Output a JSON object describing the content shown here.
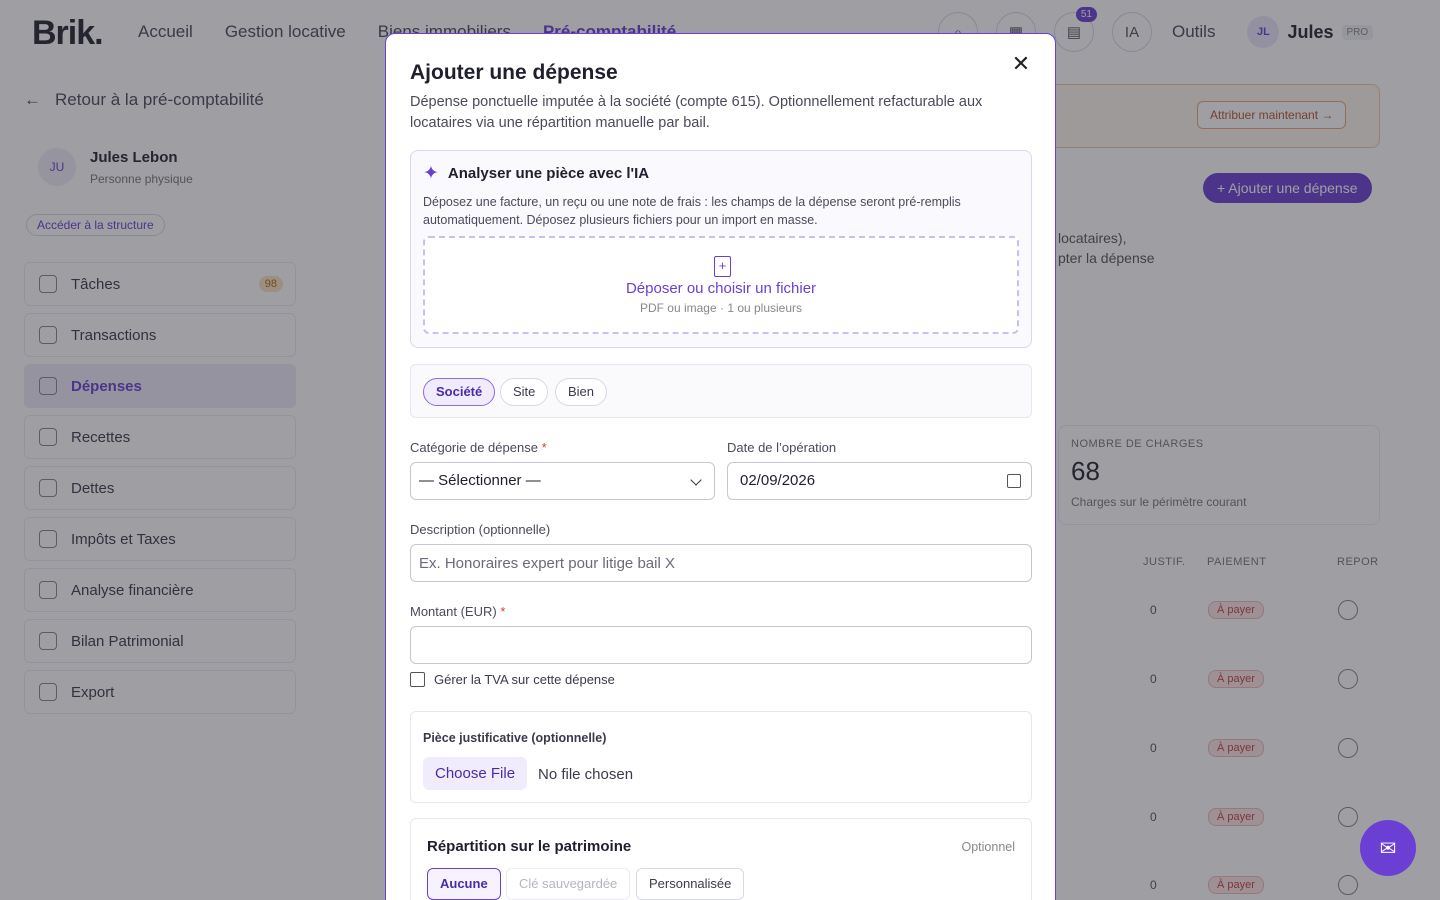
{
  "app": {
    "logo": "Brik.",
    "nav": [
      "Accueil",
      "Gestion locative",
      "Biens immobiliers",
      "Pré-comptabilité"
    ],
    "notifications_count": "51",
    "ai_label": "IA",
    "tools_label": "Outils",
    "user": {
      "initials": "JL",
      "name": "Jules",
      "plan": "PRO"
    }
  },
  "sidebar": {
    "back_label": "Retour à la pré-comptabilité",
    "profile": {
      "initials": "JU",
      "name": "Jules Lebon",
      "type": "Personne physique"
    },
    "structure_link": "Accéder à la structure",
    "items": [
      {
        "label": "Tâches",
        "badge": "98"
      },
      {
        "label": "Transactions"
      },
      {
        "label": "Dépenses"
      },
      {
        "label": "Recettes"
      },
      {
        "label": "Dettes"
      },
      {
        "label": "Impôts et Taxes"
      },
      {
        "label": "Analyse financière"
      },
      {
        "label": "Bilan Patrimonial"
      },
      {
        "label": "Export"
      }
    ]
  },
  "background": {
    "banner_button": "Attribuer maintenant →",
    "add_button": "+ Ajouter une dépense",
    "partial_text_1": "locataires),",
    "partial_text_2": "pter la dépense",
    "stat": {
      "label": "NOMBRE DE CHARGES",
      "value": "68",
      "sub": "Charges sur le périmètre courant"
    },
    "columns": [
      "JUSTIF.",
      "PAIEMENT",
      "REPOR"
    ],
    "row_count": "0",
    "row_status": "À payer"
  },
  "modal": {
    "title": "Ajouter une dépense",
    "description": "Dépense ponctuelle imputée à la société (compte 615). Optionnellement refacturable aux locataires via une répartition manuelle par bail.",
    "ai": {
      "title": "Analyser une pièce avec l'IA",
      "description": "Déposez une facture, un reçu ou une note de frais : les champs de la dépense seront pré-remplis automatiquement. Déposez plusieurs fichiers pour un import en masse.",
      "drop_title": "Déposer ou choisir un fichier",
      "drop_sub": "PDF ou image · 1 ou plusieurs"
    },
    "scope": {
      "options": [
        "Société",
        "Site",
        "Bien"
      ],
      "selected": "Société"
    },
    "category": {
      "label": "Catégorie de dépense",
      "value": "— Sélectionner —"
    },
    "date": {
      "label": "Date de l’opération",
      "value": "02/09/2026"
    },
    "description_field": {
      "label": "Description (optionnelle)",
      "placeholder": "Ex. Honoraires expert pour litige bail X",
      "value": ""
    },
    "amount": {
      "label": "Montant (EUR)",
      "value": ""
    },
    "vat_checkbox": {
      "label": "Gérer la TVA sur cette dépense",
      "checked": false
    },
    "proof": {
      "label": "Pièce justificative (optionnelle)",
      "button": "Choose File",
      "status": "No file chosen"
    },
    "repartition": {
      "title": "Répartition sur le patrimoine",
      "optional": "Optionnel",
      "options": [
        "Aucune",
        "Clé sauvegardée",
        "Personnalisée"
      ],
      "selected": "Aucune"
    },
    "required_mark": "*"
  },
  "colors": {
    "accent": "#6b3fd4",
    "danger": "#d63b3b"
  },
  "icons": {
    "close": "close-icon",
    "spark": "sparkles-icon",
    "file": "file-plus-icon",
    "calendar": "calendar-icon",
    "chevron": "chevron-down-icon",
    "chat": "chat-icon"
  }
}
